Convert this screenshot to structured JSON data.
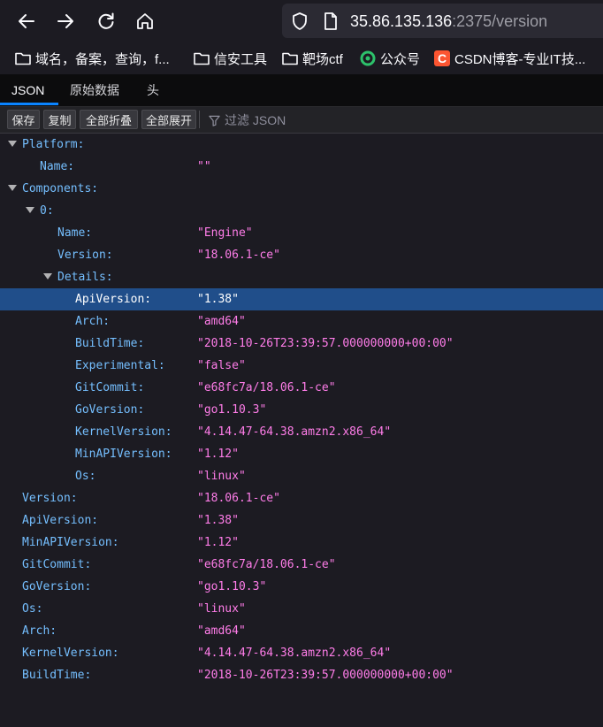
{
  "url": {
    "host": "35.86.135.136",
    "path": ":2375/version"
  },
  "bookmarks": [
    {
      "label": "域名，备案，查询，f...",
      "icon": "folder-icon"
    },
    {
      "label": "信安工具",
      "icon": "folder-icon"
    },
    {
      "label": "靶场ctf",
      "icon": "folder-icon"
    },
    {
      "label": "公众号",
      "icon": "wechat-icon"
    },
    {
      "label": "CSDN博客-专业IT技...",
      "icon": "csdn-icon"
    }
  ],
  "viewer_tabs": [
    "JSON",
    "原始数据",
    "头"
  ],
  "toolbar": {
    "save": "保存",
    "copy": "复制",
    "collapse_all": "全部折叠",
    "expand_all": "全部展开",
    "filter_placeholder": "过滤 JSON"
  },
  "tree": [
    {
      "key": "Platform:",
      "value": ""
    },
    {
      "key": "Name:",
      "value": "\"\""
    },
    {
      "key": "Components:",
      "value": ""
    },
    {
      "key": "0:",
      "value": ""
    },
    {
      "key": "Name:",
      "value": "\"Engine\""
    },
    {
      "key": "Version:",
      "value": "\"18.06.1-ce\""
    },
    {
      "key": "Details:",
      "value": ""
    },
    {
      "key": "ApiVersion:",
      "value": "\"1.38\""
    },
    {
      "key": "Arch:",
      "value": "\"amd64\""
    },
    {
      "key": "BuildTime:",
      "value": "\"2018-10-26T23:39:57.000000000+00:00\""
    },
    {
      "key": "Experimental:",
      "value": "\"false\""
    },
    {
      "key": "GitCommit:",
      "value": "\"e68fc7a/18.06.1-ce\""
    },
    {
      "key": "GoVersion:",
      "value": "\"go1.10.3\""
    },
    {
      "key": "KernelVersion:",
      "value": "\"4.14.47-64.38.amzn2.x86_64\""
    },
    {
      "key": "MinAPIVersion:",
      "value": "\"1.12\""
    },
    {
      "key": "Os:",
      "value": "\"linux\""
    },
    {
      "key": "Version:",
      "value": "\"18.06.1-ce\""
    },
    {
      "key": "ApiVersion:",
      "value": "\"1.38\""
    },
    {
      "key": "MinAPIVersion:",
      "value": "\"1.12\""
    },
    {
      "key": "GitCommit:",
      "value": "\"e68fc7a/18.06.1-ce\""
    },
    {
      "key": "GoVersion:",
      "value": "\"go1.10.3\""
    },
    {
      "key": "Os:",
      "value": "\"linux\""
    },
    {
      "key": "Arch:",
      "value": "\"amd64\""
    },
    {
      "key": "KernelVersion:",
      "value": "\"4.14.47-64.38.amzn2.x86_64\""
    },
    {
      "key": "BuildTime:",
      "value": "\"2018-10-26T23:39:57.000000000+00:00\""
    }
  ]
}
